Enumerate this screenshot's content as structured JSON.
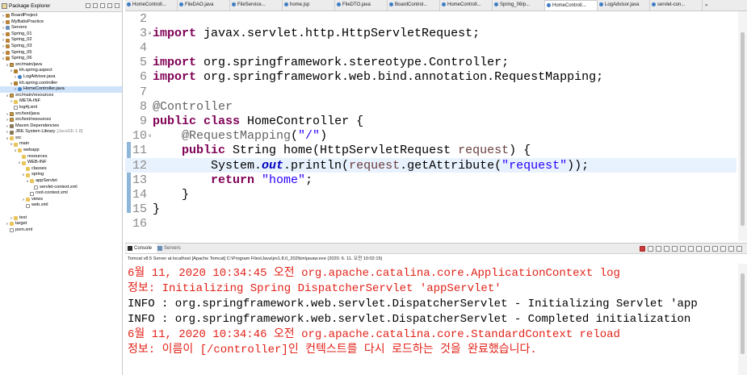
{
  "explorer": {
    "title": "Package Explorer",
    "items": [
      {
        "label": "BoardProject",
        "icon": "project-icon",
        "level": 0,
        "twisty": ">"
      },
      {
        "label": "MyBatisPractice",
        "icon": "project-icon",
        "level": 0,
        "twisty": ">"
      },
      {
        "label": "Servers",
        "icon": "server-icon",
        "level": 0,
        "twisty": ">"
      },
      {
        "label": "Spring_01",
        "icon": "project-icon",
        "level": 0,
        "twisty": ">"
      },
      {
        "label": "Spring_02",
        "icon": "project-icon",
        "level": 0,
        "twisty": ">"
      },
      {
        "label": "Spring_03",
        "icon": "project-icon",
        "level": 0,
        "twisty": ">"
      },
      {
        "label": "Spring_05",
        "icon": "project-icon",
        "level": 0,
        "twisty": ">"
      },
      {
        "label": "Spring_06",
        "icon": "project-icon",
        "level": 0,
        "twisty": "v"
      },
      {
        "label": "src/main/java",
        "icon": "srcfolder-icon",
        "level": 1,
        "twisty": "v"
      },
      {
        "label": "kh.spring.aspect",
        "icon": "package-icon",
        "level": 2,
        "twisty": "v"
      },
      {
        "label": "LogAdvisor.java",
        "icon": "java-icon",
        "level": 3,
        "twisty": ">"
      },
      {
        "label": "kh.spring.controller",
        "icon": "package-icon",
        "level": 2,
        "twisty": "v"
      },
      {
        "label": "HomeController.java",
        "icon": "java-icon",
        "level": 3,
        "twisty": ">",
        "selected": true
      },
      {
        "label": "src/main/resources",
        "icon": "srcfolder-icon",
        "level": 1,
        "twisty": "v"
      },
      {
        "label": "META-INF",
        "icon": "folder-icon",
        "level": 2,
        "twisty": ">"
      },
      {
        "label": "log4j.xml",
        "icon": "file-icon",
        "level": 2,
        "twisty": ""
      },
      {
        "label": "src/test/java",
        "icon": "srcfolder-icon",
        "level": 1,
        "twisty": ">"
      },
      {
        "label": "src/test/resources",
        "icon": "srcfolder-icon",
        "level": 1,
        "twisty": ">"
      },
      {
        "label": "Maven Dependencies",
        "icon": "library-icon",
        "level": 1,
        "twisty": ">"
      },
      {
        "label": "JRE System Library",
        "icon": "library-icon",
        "level": 1,
        "twisty": ">",
        "extra": "[JavaSE-1.8]"
      },
      {
        "label": "src",
        "icon": "folder-icon",
        "level": 1,
        "twisty": "v"
      },
      {
        "label": "main",
        "icon": "folder-icon",
        "level": 2,
        "twisty": "v"
      },
      {
        "label": "webapp",
        "icon": "folder-icon",
        "level": 3,
        "twisty": "v"
      },
      {
        "label": "resources",
        "icon": "folder-icon",
        "level": 4,
        "twisty": ""
      },
      {
        "label": "WEB-INF",
        "icon": "folder-icon",
        "level": 4,
        "twisty": "v"
      },
      {
        "label": "classes",
        "icon": "folder-icon",
        "level": 5,
        "twisty": ""
      },
      {
        "label": "spring",
        "icon": "folder-icon",
        "level": 5,
        "twisty": "v"
      },
      {
        "label": "appServlet",
        "icon": "folder-icon",
        "level": 6,
        "twisty": "v"
      },
      {
        "label": "servlet-context.xml",
        "icon": "file-icon",
        "level": 7,
        "twisty": ""
      },
      {
        "label": "root-context.xml",
        "icon": "file-icon",
        "level": 6,
        "twisty": ""
      },
      {
        "label": "views",
        "icon": "folder-icon",
        "level": 5,
        "twisty": ">"
      },
      {
        "label": "web.xml",
        "icon": "file-icon",
        "level": 5,
        "twisty": ""
      },
      {
        "label": "",
        "icon": "",
        "level": 0,
        "twisty": ""
      },
      {
        "label": "test",
        "icon": "folder-icon",
        "level": 2,
        "twisty": ">"
      },
      {
        "label": "target",
        "icon": "folder-icon",
        "level": 1,
        "twisty": ">"
      },
      {
        "label": "pom.xml",
        "icon": "file-icon",
        "level": 1,
        "twisty": ""
      }
    ]
  },
  "editor": {
    "tabs": [
      {
        "label": "HomeControll...",
        "active": false
      },
      {
        "label": "FileDAO.java",
        "active": false
      },
      {
        "label": "FileService...",
        "active": false
      },
      {
        "label": "home.jsp",
        "active": false
      },
      {
        "label": "FileDTO.java",
        "active": false
      },
      {
        "label": "BoardControl...",
        "active": false
      },
      {
        "label": "HomeControll...",
        "active": false
      },
      {
        "label": "Spring_06/p...",
        "active": false
      },
      {
        "label": "HomeControll...",
        "active": true
      },
      {
        "label": "LogAdvisor.java",
        "active": false
      },
      {
        "label": "servlet-con...",
        "active": false
      }
    ],
    "more_tabs": "»",
    "lines": [
      {
        "no": "2",
        "fold": "",
        "segments": []
      },
      {
        "no": "3",
        "fold": "⊕",
        "segments": [
          {
            "t": "import",
            "c": "kw"
          },
          {
            "t": " javax.servlet.http.HttpServletRequest;",
            "c": ""
          }
        ]
      },
      {
        "no": "4",
        "fold": "",
        "segments": []
      },
      {
        "no": "5",
        "fold": "",
        "segments": [
          {
            "t": "import",
            "c": "kw"
          },
          {
            "t": " org.springframework.stereotype.Controller;",
            "c": ""
          }
        ]
      },
      {
        "no": "6",
        "fold": "",
        "segments": [
          {
            "t": "import",
            "c": "kw"
          },
          {
            "t": " org.springframework.web.bind.annotation.RequestMapping;",
            "c": ""
          }
        ]
      },
      {
        "no": "7",
        "fold": "",
        "segments": []
      },
      {
        "no": "8",
        "fold": "",
        "segments": [
          {
            "t": "@Controller",
            "c": "ann"
          }
        ]
      },
      {
        "no": "9",
        "fold": "",
        "segments": [
          {
            "t": "public",
            "c": "kw"
          },
          {
            "t": " ",
            "c": ""
          },
          {
            "t": "class",
            "c": "kw"
          },
          {
            "t": " HomeController {",
            "c": ""
          }
        ]
      },
      {
        "no": "10",
        "fold": "⊖",
        "segments": [
          {
            "t": "    @RequestMapping",
            "c": "ann"
          },
          {
            "t": "(",
            "c": ""
          },
          {
            "t": "\"/\"",
            "c": "str"
          },
          {
            "t": ")",
            "c": ""
          }
        ]
      },
      {
        "no": "11",
        "fold": "",
        "segments": [
          {
            "t": "    ",
            "c": ""
          },
          {
            "t": "public",
            "c": "kw"
          },
          {
            "t": " String home(HttpServletRequest ",
            "c": ""
          },
          {
            "t": "request",
            "c": "param"
          },
          {
            "t": ") {",
            "c": ""
          }
        ]
      },
      {
        "no": "12",
        "fold": "",
        "current": true,
        "segments": [
          {
            "t": "        System.",
            "c": ""
          },
          {
            "t": "out",
            "c": "field"
          },
          {
            "t": ".println(",
            "c": ""
          },
          {
            "t": "request",
            "c": "param"
          },
          {
            "t": ".getAttribute(",
            "c": ""
          },
          {
            "t": "\"request\"",
            "c": "str"
          },
          {
            "t": "));",
            "c": ""
          }
        ]
      },
      {
        "no": "13",
        "fold": "",
        "segments": [
          {
            "t": "        ",
            "c": ""
          },
          {
            "t": "return",
            "c": "kw"
          },
          {
            "t": " ",
            "c": ""
          },
          {
            "t": "\"home\"",
            "c": "str"
          },
          {
            "t": ";",
            "c": ""
          }
        ]
      },
      {
        "no": "14",
        "fold": "",
        "segments": [
          {
            "t": "    }",
            "c": ""
          }
        ]
      },
      {
        "no": "15",
        "fold": "",
        "segments": [
          {
            "t": "}",
            "c": ""
          }
        ]
      },
      {
        "no": "16",
        "fold": "",
        "segments": []
      }
    ]
  },
  "console": {
    "tabs": [
      {
        "label": "Console",
        "active": true
      },
      {
        "label": "Servers",
        "active": false
      }
    ],
    "status": "Tomcat v8.5 Server at localhost [Apache Tomcat] C:\\Program Files\\Java\\jre1.8.0_202\\bin\\javaw.exe (2020. 6. 11. 오전 10:02:15)",
    "lines": [
      {
        "text": "6월 11, 2020 10:34:45 오전 org.apache.catalina.core.ApplicationContext log",
        "color": "red"
      },
      {
        "text": "정보: Initializing Spring DispatcherServlet 'appServlet'",
        "color": "red"
      },
      {
        "text": "INFO : org.springframework.web.servlet.DispatcherServlet - Initializing Servlet 'app",
        "color": "black"
      },
      {
        "text": "INFO : org.springframework.web.servlet.DispatcherServlet - Completed initialization",
        "color": "black"
      },
      {
        "text": "6월 11, 2020 10:34:46 오전 org.apache.catalina.core.StandardContext reload",
        "color": "red"
      },
      {
        "text": "정보: 이름이 [/controller]인 컨텍스트를 다시 로드하는 것을 완료했습니다.",
        "color": "red"
      }
    ]
  },
  "colors": {
    "keyword": "#7f0055",
    "string": "#2a00ff",
    "annotation": "#646464",
    "console_red": "#e2231a",
    "current_line": "#e8f2fe"
  }
}
